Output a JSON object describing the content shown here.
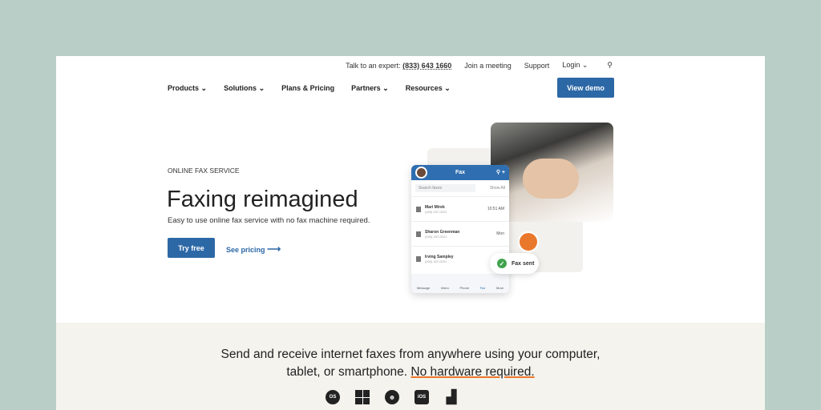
{
  "utility": {
    "expert_label": "Talk to an expert:",
    "phone": "(833) 643 1660",
    "join": "Join a meeting",
    "support": "Support",
    "login": "Login",
    "search_icon": "search-icon"
  },
  "nav": {
    "items": [
      "Products",
      "Solutions",
      "Plans & Pricing",
      "Partners",
      "Resources"
    ],
    "demo": "View demo"
  },
  "hero": {
    "eyebrow": "ONLINE FAX SERVICE",
    "title": "Faxing reimagined",
    "subtitle": "Easy to use online fax service with no fax machine required.",
    "try": "Try free",
    "see": "See pricing"
  },
  "app": {
    "title": "Fax",
    "search_placeholder": "Search faxes",
    "filter": "Show All",
    "rows": [
      {
        "name": "Mari Mirek",
        "number": "(430) 437-0221",
        "time": "10:51 AM"
      },
      {
        "name": "Sharon Greenman",
        "number": "(430) 437-0221",
        "time": "Mon"
      },
      {
        "name": "Irving Sampley",
        "number": "(430) 437-0221",
        "time": ""
      }
    ],
    "tabs": [
      "Message",
      "Video",
      "Phone",
      "Fax",
      "More"
    ],
    "toast": "Fax sent"
  },
  "band": {
    "line1": "Send and receive internet faxes from anywhere using your computer,",
    "line2": "tablet, or smartphone.",
    "highlight": "No hardware required.",
    "platforms": [
      "macOS",
      "Windows",
      "Web",
      "iOS",
      "Android"
    ]
  },
  "colors": {
    "accent": "#2d68a6",
    "underline": "#e9782c",
    "background": "#b8cec6"
  }
}
